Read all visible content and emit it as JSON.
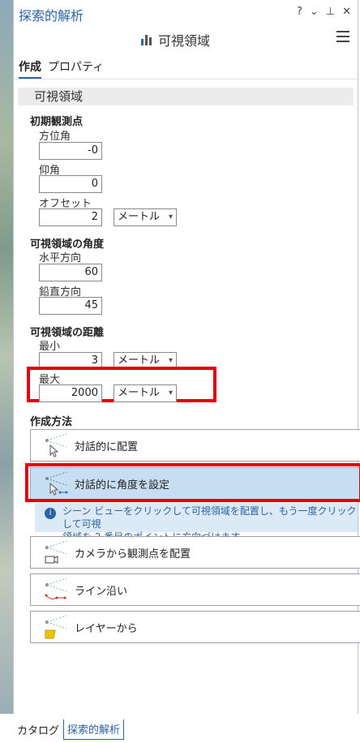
{
  "header": {
    "title": "探索的解析",
    "controls": {
      "help": "?",
      "options": "⌄",
      "pin": "⊥",
      "close": "✕"
    }
  },
  "tool": {
    "name": "可視領域",
    "icon": "viewshed-tool-icon"
  },
  "tabs": [
    {
      "label": "作成",
      "active": true
    },
    {
      "label": "プロパティ",
      "active": false
    }
  ],
  "section_title": "可視領域",
  "observer": {
    "heading": "初期観測点",
    "azimuth": {
      "label": "方位角",
      "value": "-0"
    },
    "pitch": {
      "label": "仰角",
      "value": "0"
    },
    "offset": {
      "label": "オフセット",
      "value": "2",
      "unit": "メートル"
    }
  },
  "angles": {
    "heading": "可視領域の角度",
    "horizontal": {
      "label": "水平方向",
      "value": "60"
    },
    "vertical": {
      "label": "鉛直方向",
      "value": "45"
    }
  },
  "distance": {
    "heading": "可視領域の距離",
    "min": {
      "label": "最小",
      "value": "3",
      "unit": "メートル"
    },
    "max": {
      "label": "最大",
      "value": "2000",
      "unit": "メートル"
    }
  },
  "creation": {
    "heading": "作成方法",
    "methods": [
      {
        "label": "対話的に配置",
        "icon": "interactive-place-icon",
        "selected": false
      },
      {
        "label": "対話的に角度を設定",
        "icon": "interactive-angle-icon",
        "selected": true
      },
      {
        "label": "カメラから観測点を配置",
        "icon": "camera-observer-icon",
        "selected": false
      },
      {
        "label": "ライン沿い",
        "icon": "along-line-icon",
        "selected": false
      },
      {
        "label": "レイヤーから",
        "icon": "from-layer-icon",
        "selected": false
      }
    ],
    "info_line1": "シーン ビューをクリックして可視領域を配置し、もう一度クリックして可視",
    "info_line2": "領域を 2 番目のポイントに方向づけます。"
  },
  "bottom_tabs": [
    {
      "label": "カタログ",
      "active": false
    },
    {
      "label": "探索的解析",
      "active": true
    }
  ],
  "colors": {
    "accent": "#2a63a6",
    "highlight": "#e00012",
    "selected_bg": "#c7ddf1"
  }
}
